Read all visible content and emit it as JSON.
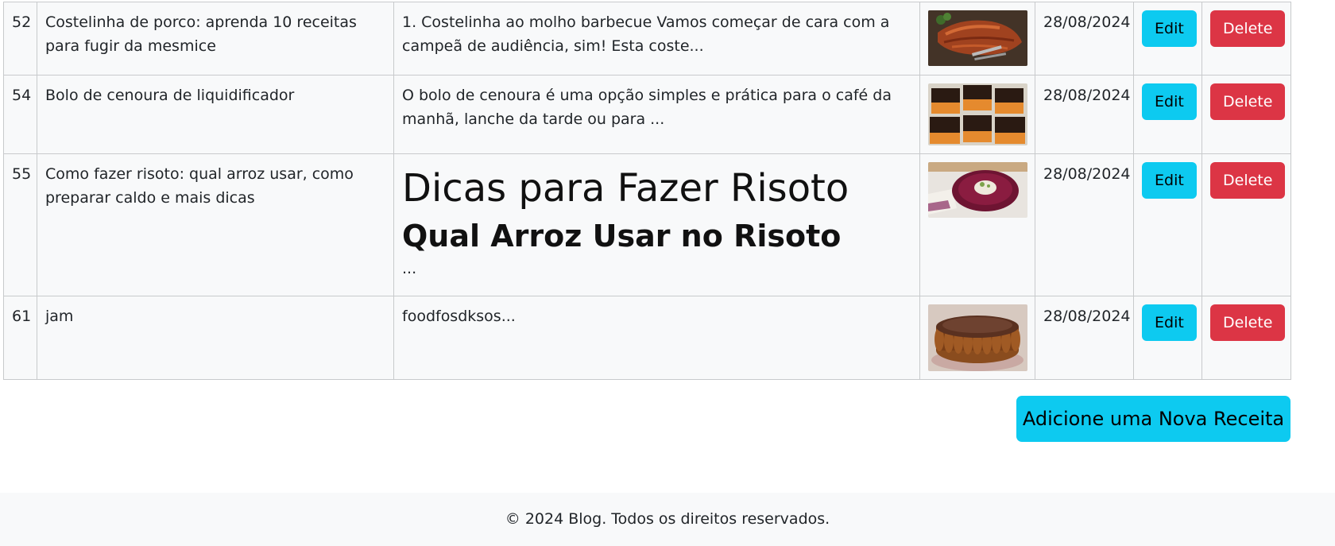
{
  "recipes": [
    {
      "id": "52",
      "title": "Costelinha de porco: aprenda 10 receitas para fugir da mesmice",
      "content": "1. Costelinha ao molho barbecue Vamos começar de cara com a campeã de audiência, sim! Esta coste...",
      "image_icon": "ribs-photo",
      "date": "28/08/2024",
      "edit_label": "Edit",
      "delete_label": "Delete"
    },
    {
      "id": "54",
      "title": "Bolo de cenoura de liquidificador",
      "content": "O bolo de cenoura é uma opção simples e prática para o café da manhã, lanche da tarde ou para ...",
      "image_icon": "carrot-cake-photo",
      "date": "28/08/2024",
      "edit_label": "Edit",
      "delete_label": "Delete"
    },
    {
      "id": "55",
      "title": "Como fazer risoto: qual arroz usar, como preparar caldo e mais dicas",
      "content_h1": "Dicas para Fazer Risoto",
      "content_h2": "Qual Arroz Usar no Risoto",
      "content_tail": "...",
      "image_icon": "risotto-photo",
      "date": "28/08/2024",
      "edit_label": "Edit",
      "delete_label": "Delete"
    },
    {
      "id": "61",
      "title": "jam",
      "content": "foodfosdksos...",
      "image_icon": "chocolate-pie-photo",
      "date": "28/08/2024",
      "edit_label": "Edit",
      "delete_label": "Delete"
    }
  ],
  "add_button_label": "Adicione uma Nova Receita",
  "footer_text": "© 2024 Blog. Todos os direitos reservados.",
  "colors": {
    "edit_button": "#0dcaf0",
    "delete_button": "#dc3545",
    "table_background": "#f8f9fa",
    "footer_background": "#f8f9fa"
  }
}
